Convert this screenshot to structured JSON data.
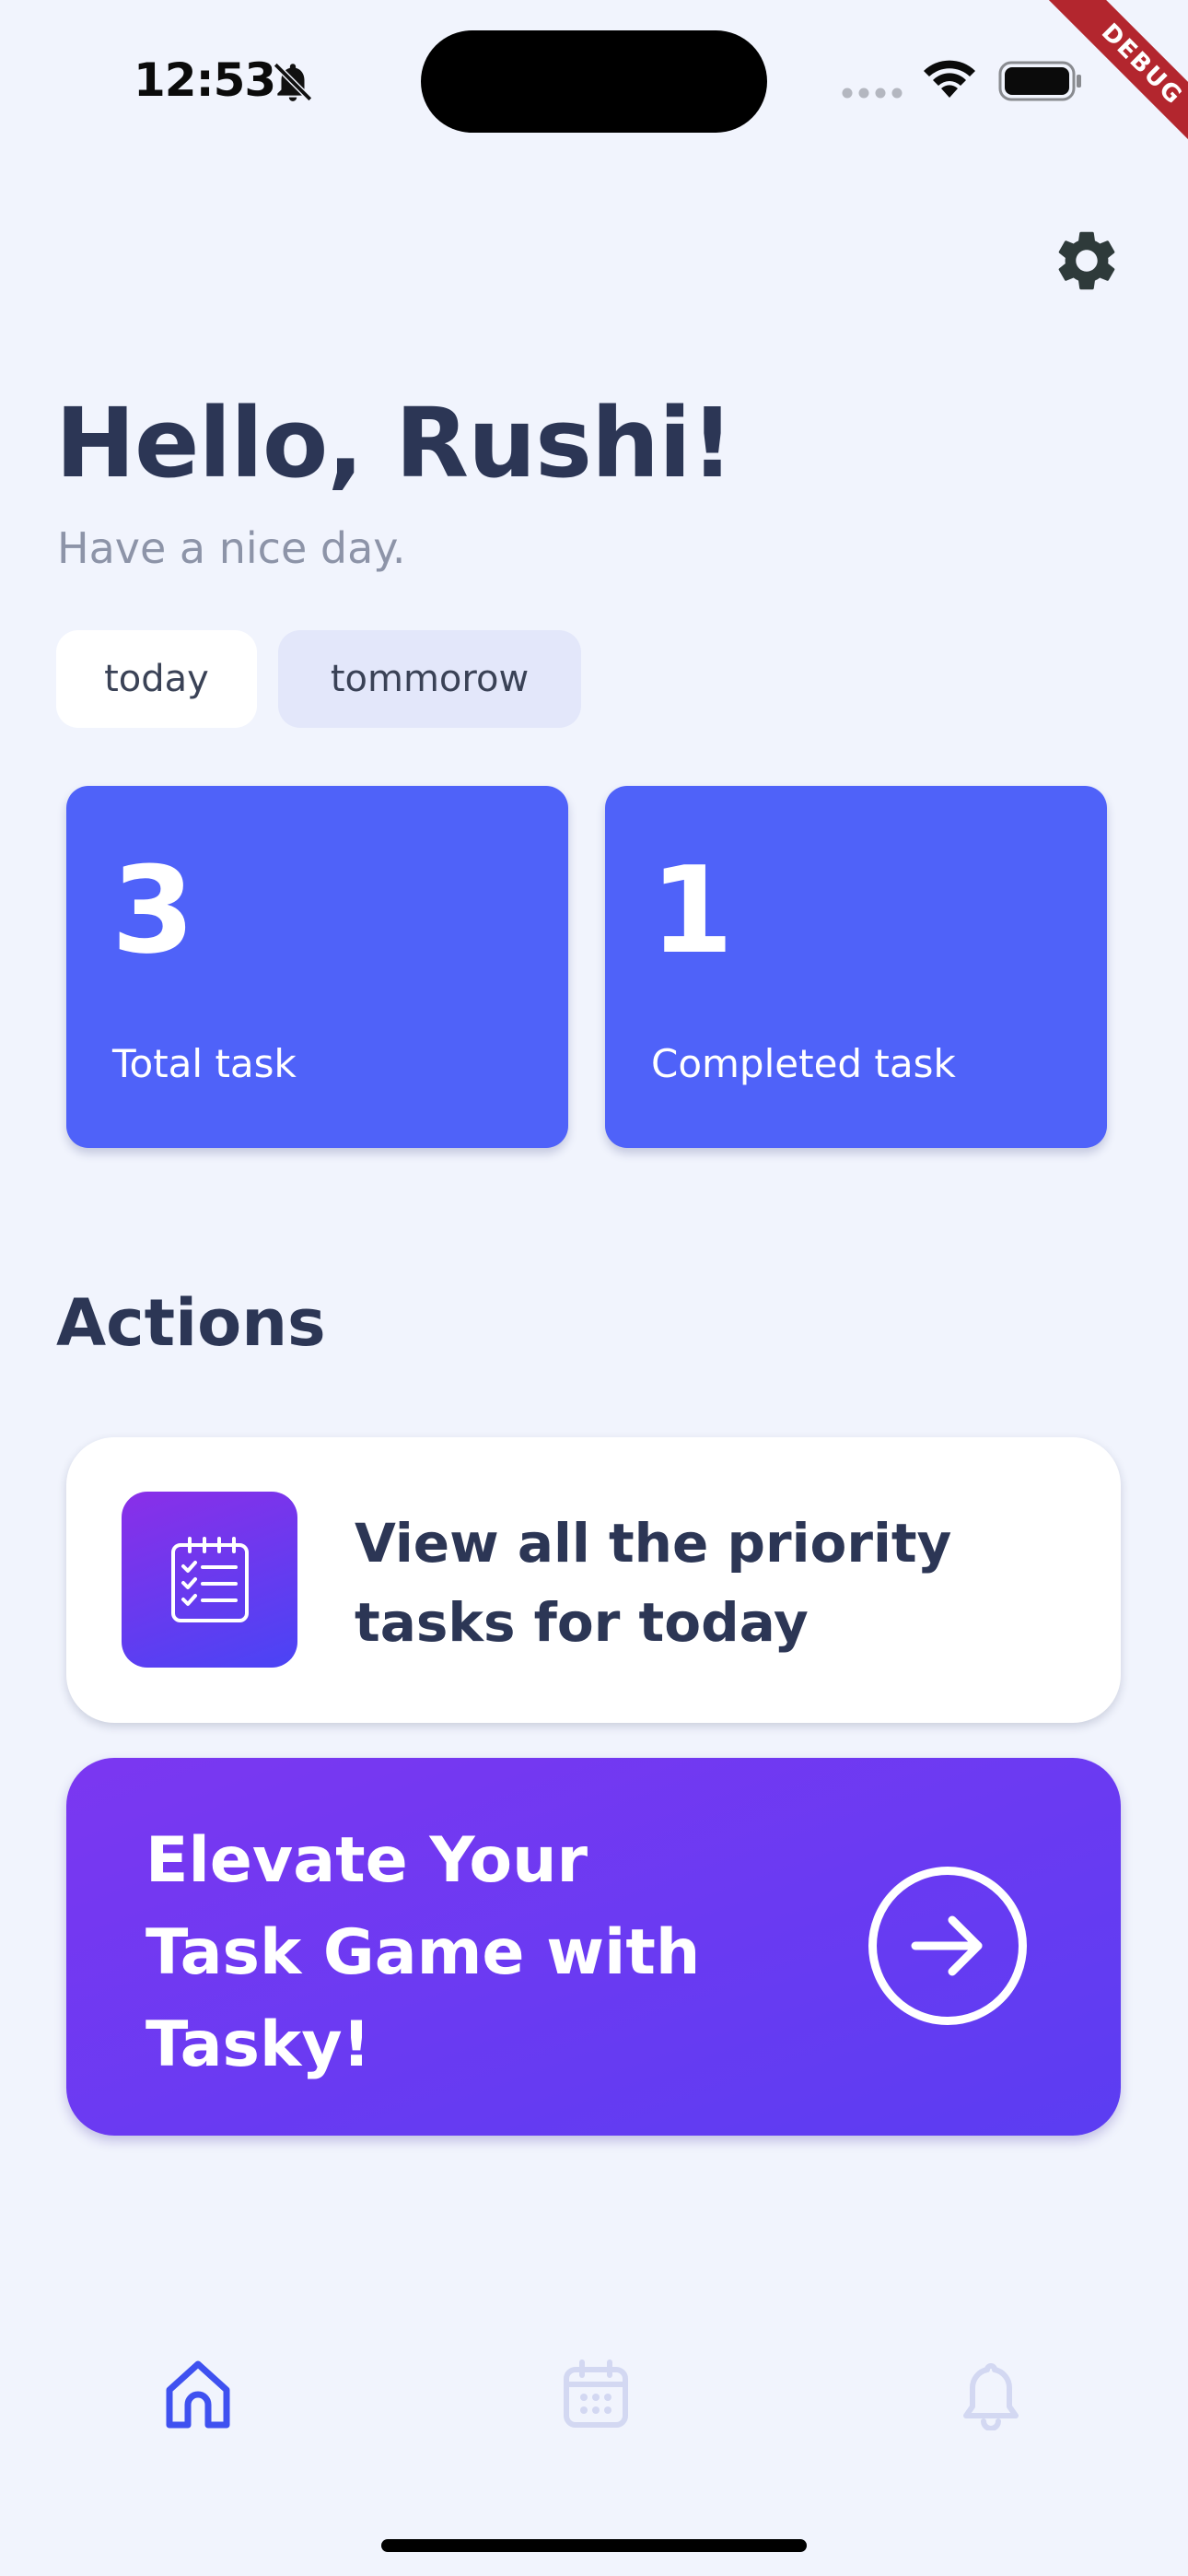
{
  "status_bar": {
    "time": "12:53",
    "icons": [
      "bell-off-icon",
      "signal-icon",
      "wifi-icon",
      "battery-icon"
    ],
    "debug_label": "DEBUG"
  },
  "header": {
    "settings_icon": "gear-icon"
  },
  "greeting": {
    "title": "Hello, Rushi!",
    "subtitle": "Have a nice day."
  },
  "filters": [
    {
      "label": "today",
      "selected": true
    },
    {
      "label": "tommorow",
      "selected": false
    }
  ],
  "stats": [
    {
      "value": "3",
      "label": "Total task"
    },
    {
      "value": "1",
      "label": "Completed task"
    }
  ],
  "actions": {
    "title": "Actions",
    "priority_card": {
      "icon": "checklist-icon",
      "text": "View all the priority tasks for today"
    },
    "promo_card": {
      "text": "Elevate Your Task Game with Tasky!",
      "icon": "arrow-right-icon"
    }
  },
  "bottom_nav": [
    {
      "name": "home",
      "icon": "home-icon",
      "active": true
    },
    {
      "name": "calendar",
      "icon": "calendar-icon",
      "active": false
    },
    {
      "name": "notifications",
      "icon": "bell-icon",
      "active": false
    }
  ],
  "colors": {
    "background": "#F1F4FD",
    "primary": "#4F62F9",
    "text": "#2C3655",
    "subtitle": "#8D94A8",
    "promo_gradient_start": "#7B37F1",
    "promo_gradient_end": "#5B3DF2",
    "nav_active": "#3F51F0",
    "nav_inactive": "#D3D8F2"
  }
}
